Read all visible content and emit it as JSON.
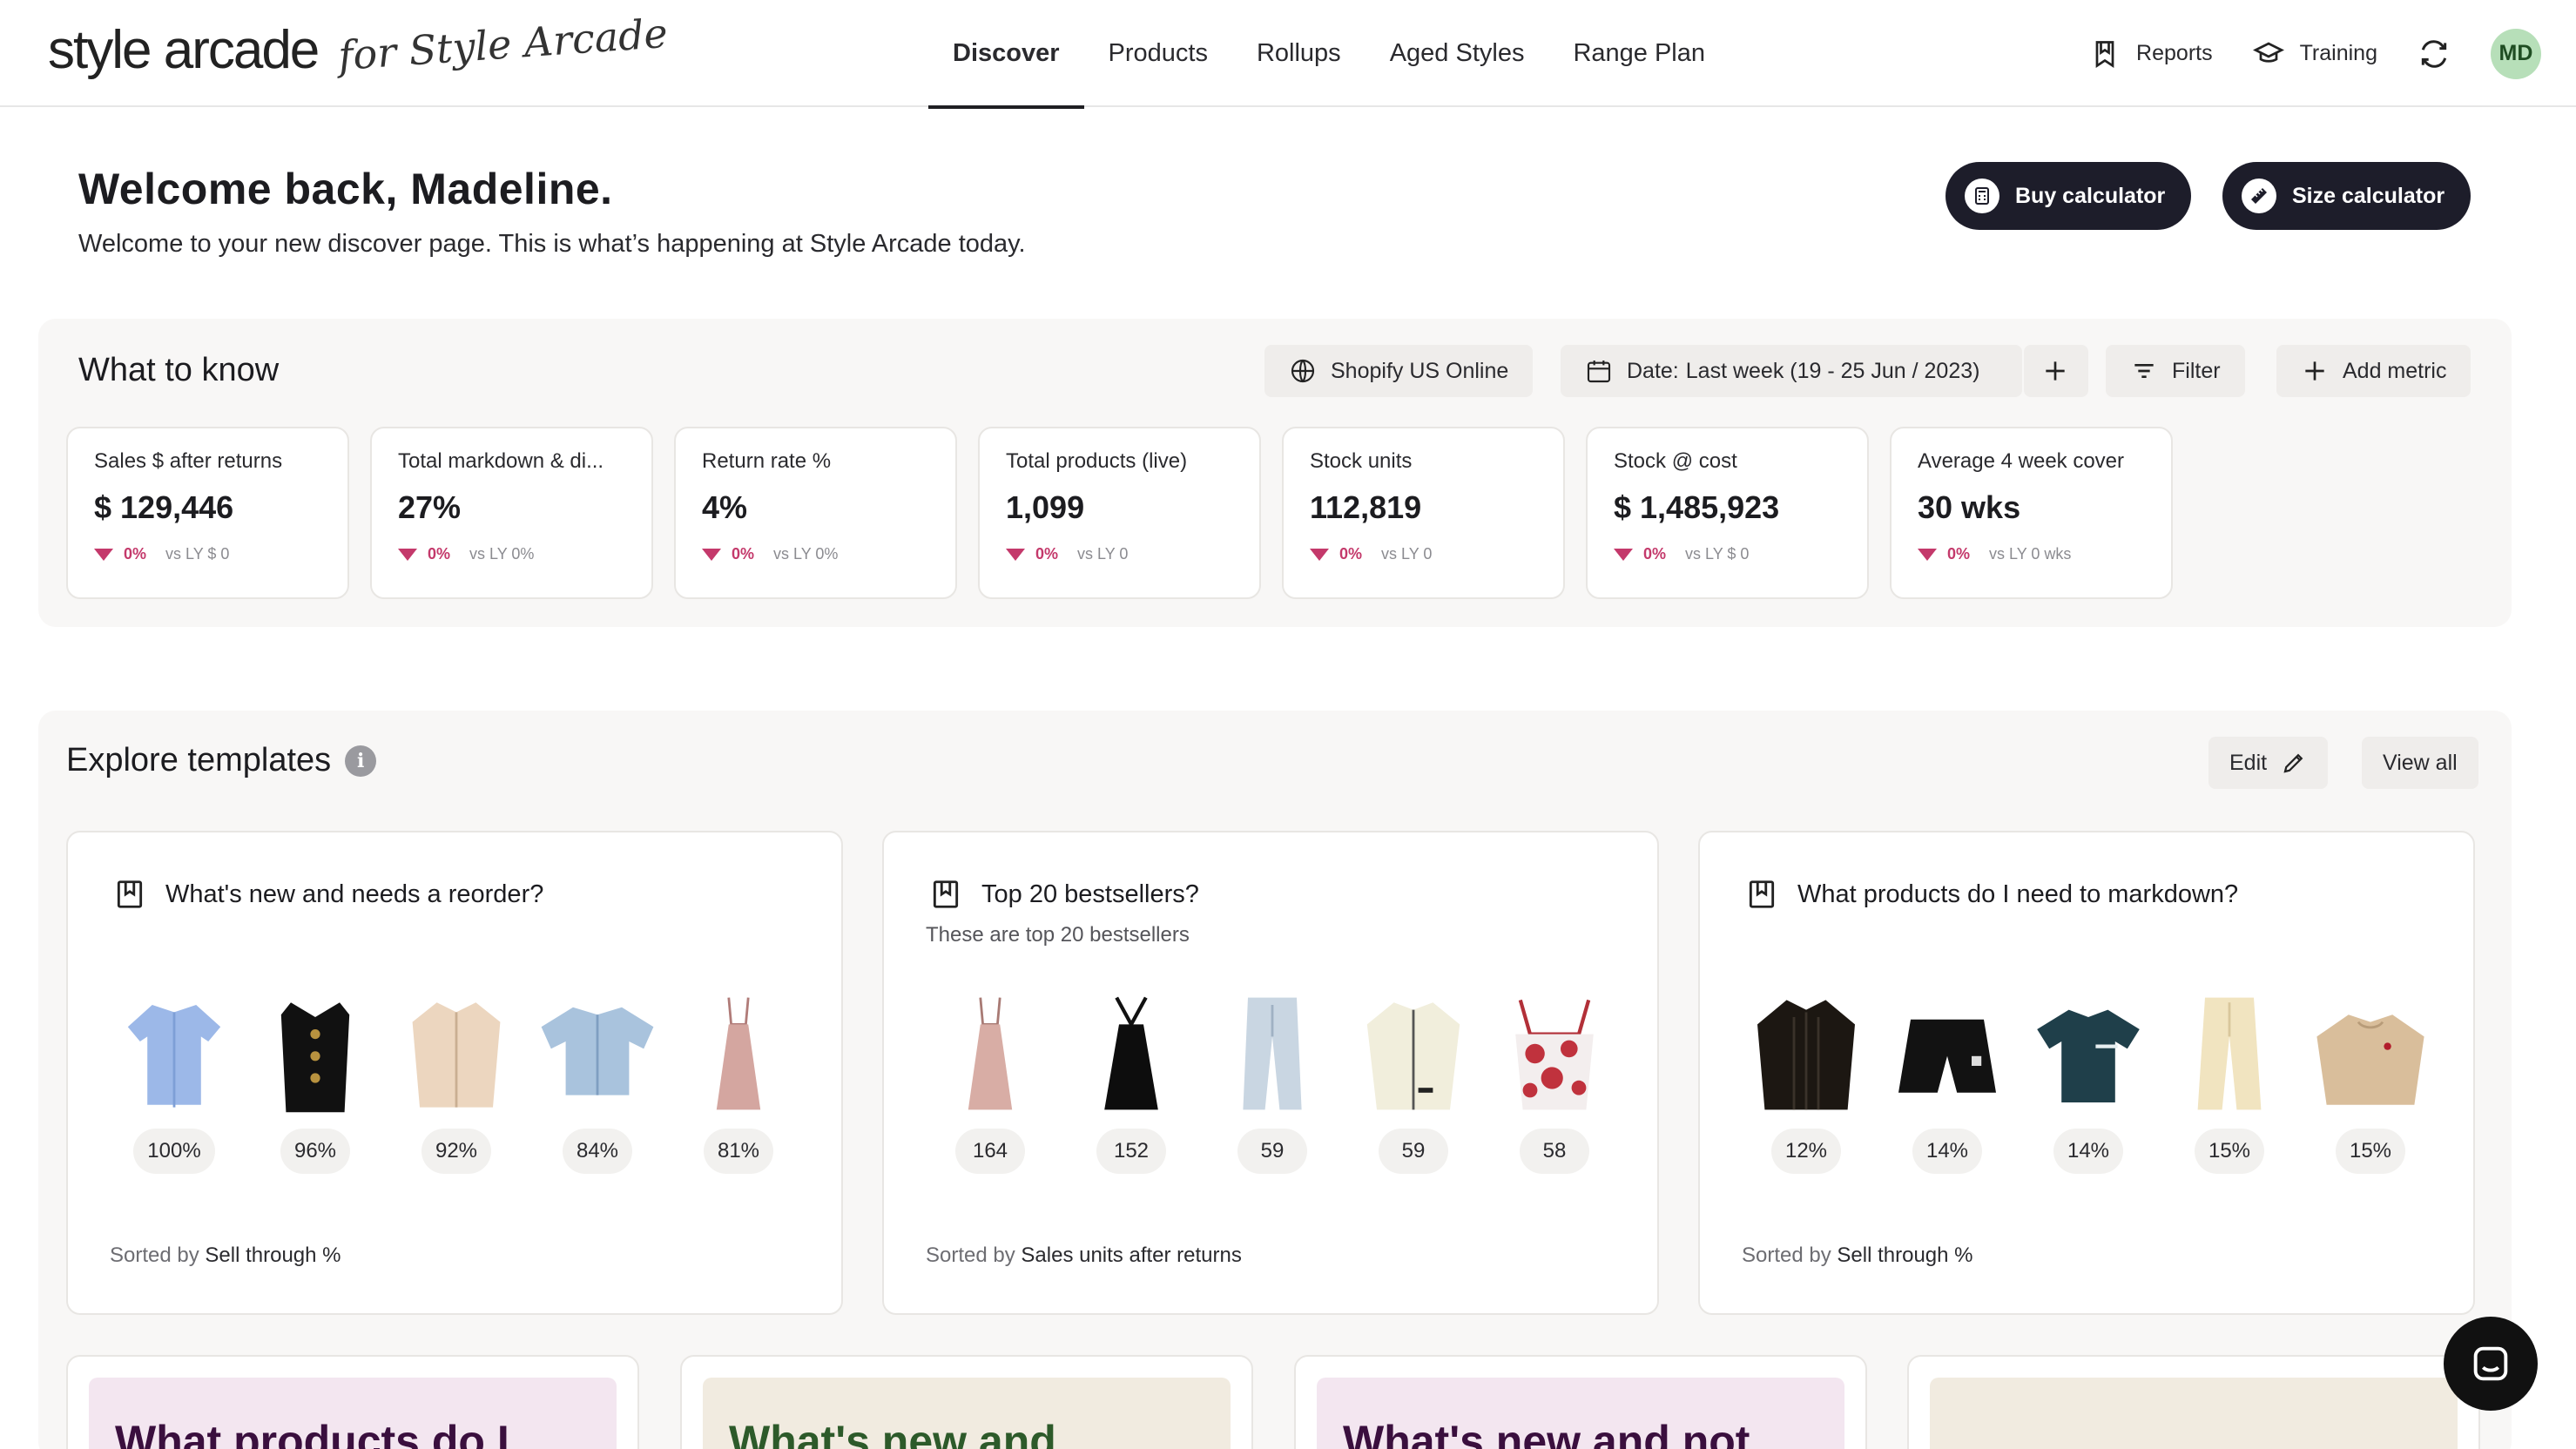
{
  "brand": {
    "logo": "style arcade",
    "sub": "for Style Arcade"
  },
  "nav": {
    "items": [
      {
        "label": "Discover",
        "active": true
      },
      {
        "label": "Products"
      },
      {
        "label": "Rollups"
      },
      {
        "label": "Aged Styles"
      },
      {
        "label": "Range Plan"
      }
    ]
  },
  "header": {
    "reports": "Reports",
    "training": "Training",
    "avatar": "MD"
  },
  "welcome": {
    "title": "Welcome back, Madeline.",
    "subtitle": "Welcome to your new discover page. This is what’s happening at Style Arcade today.",
    "buy_calc": "Buy calculator",
    "size_calc": "Size calculator"
  },
  "what_to_know": {
    "title": "What to know",
    "store": "Shopify US Online",
    "date_prefix": "Date:",
    "date_value": "Last week (19 - 25 Jun / 2023)",
    "filter": "Filter",
    "add_metric": "Add metric",
    "metrics": [
      {
        "label": "Sales $ after returns",
        "value": "$ 129,446",
        "delta": "0%",
        "ly": "vs LY $ 0"
      },
      {
        "label": "Total markdown & di...",
        "value": "27%",
        "delta": "0%",
        "ly": "vs LY 0%"
      },
      {
        "label": "Return rate %",
        "value": "4%",
        "delta": "0%",
        "ly": "vs LY 0%"
      },
      {
        "label": "Total products (live)",
        "value": "1,099",
        "delta": "0%",
        "ly": "vs LY 0"
      },
      {
        "label": "Stock units",
        "value": "112,819",
        "delta": "0%",
        "ly": "vs LY 0"
      },
      {
        "label": "Stock @ cost",
        "value": "$ 1,485,923",
        "delta": "0%",
        "ly": "vs LY $ 0"
      },
      {
        "label": "Average 4 week cover",
        "value": "30 wks",
        "delta": "0%",
        "ly": "vs LY 0 wks"
      }
    ]
  },
  "explore": {
    "title": "Explore templates",
    "edit": "Edit",
    "view_all": "View all",
    "templates": [
      {
        "title": "What's new and needs a reorder?",
        "subtitle": "",
        "sorted_prefix": "Sorted by",
        "sorted_by": "Sell through %",
        "products": [
          {
            "badge": "100%",
            "icon": "shirt-icon"
          },
          {
            "badge": "96%",
            "icon": "vest-icon"
          },
          {
            "badge": "92%",
            "icon": "jacket-icon"
          },
          {
            "badge": "84%",
            "icon": "denim-top-icon"
          },
          {
            "badge": "81%",
            "icon": "slip-dress-icon"
          }
        ]
      },
      {
        "title": "Top 20 bestsellers?",
        "subtitle": "These are top 20 bestsellers",
        "sorted_prefix": "Sorted by",
        "sorted_by": "Sales units after returns",
        "products": [
          {
            "badge": "164",
            "icon": "slip-dress-icon"
          },
          {
            "badge": "152",
            "icon": "halter-dress-icon"
          },
          {
            "badge": "59",
            "icon": "jeans-icon"
          },
          {
            "badge": "59",
            "icon": "zip-jacket-icon"
          },
          {
            "badge": "58",
            "icon": "floral-top-icon"
          }
        ]
      },
      {
        "title": "What products do I need to markdown?",
        "subtitle": "",
        "sorted_prefix": "Sorted by",
        "sorted_by": "Sell through %",
        "products": [
          {
            "badge": "12%",
            "icon": "blouse-icon"
          },
          {
            "badge": "14%",
            "icon": "shorts-icon"
          },
          {
            "badge": "14%",
            "icon": "tshirt-icon"
          },
          {
            "badge": "15%",
            "icon": "trousers-icon"
          },
          {
            "badge": "15%",
            "icon": "sweater-icon"
          }
        ]
      }
    ]
  },
  "bottom_cards": [
    {
      "text": "What products do I",
      "bg": "#f3e6f0",
      "color": "#3a0f3e"
    },
    {
      "text": "What's new and",
      "bg": "#f1ebe0",
      "color": "#2d5a2a"
    },
    {
      "text": "What's new and not",
      "bg": "#f3e6f0",
      "color": "#3a0f3e"
    },
    {
      "text": "",
      "bg": "#f1ebe0",
      "color": "#2d5a2a"
    }
  ]
}
